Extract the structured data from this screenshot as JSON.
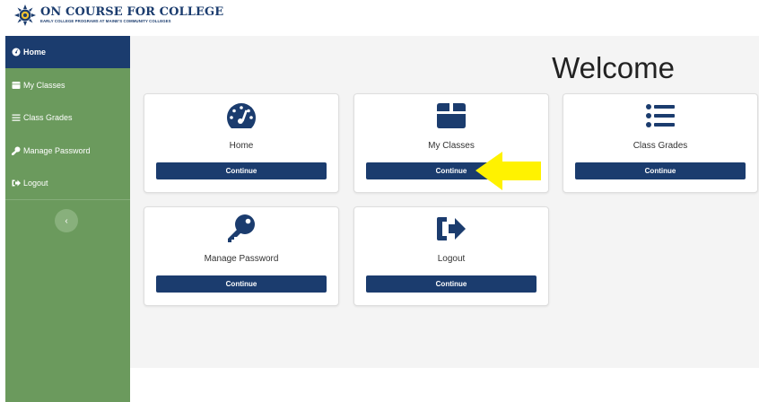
{
  "logo": {
    "title": "ON COURSE FOR COLLEGE",
    "subtitle": "EARLY COLLEGE PROGRAMS AT MAINE'S COMMUNITY COLLEGES",
    "icon": "sunburst-badge-icon"
  },
  "sidebar": {
    "items": [
      {
        "label": "Home",
        "icon": "dashboard-icon",
        "active": true
      },
      {
        "label": "My Classes",
        "icon": "box-icon"
      },
      {
        "label": "Class Grades",
        "icon": "list-icon"
      },
      {
        "label": "Manage Password",
        "icon": "key-icon"
      },
      {
        "label": "Logout",
        "icon": "sign-out-icon"
      }
    ],
    "collapse": "‹"
  },
  "main": {
    "heading": "Welcome",
    "cards": [
      {
        "label": "Home",
        "button": "Continue",
        "icon": "dashboard-icon"
      },
      {
        "label": "My Classes",
        "button": "Continue",
        "icon": "box-icon"
      },
      {
        "label": "Class Grades",
        "button": "Continue",
        "icon": "list-icon"
      },
      {
        "label": "Manage Password",
        "button": "Continue",
        "icon": "key-icon"
      },
      {
        "label": "Logout",
        "button": "Continue",
        "icon": "sign-out-icon"
      }
    ]
  },
  "colors": {
    "navy": "#1b3c6e",
    "sidebar_green": "#6b9a5d",
    "highlight_arrow": "#fff200"
  }
}
